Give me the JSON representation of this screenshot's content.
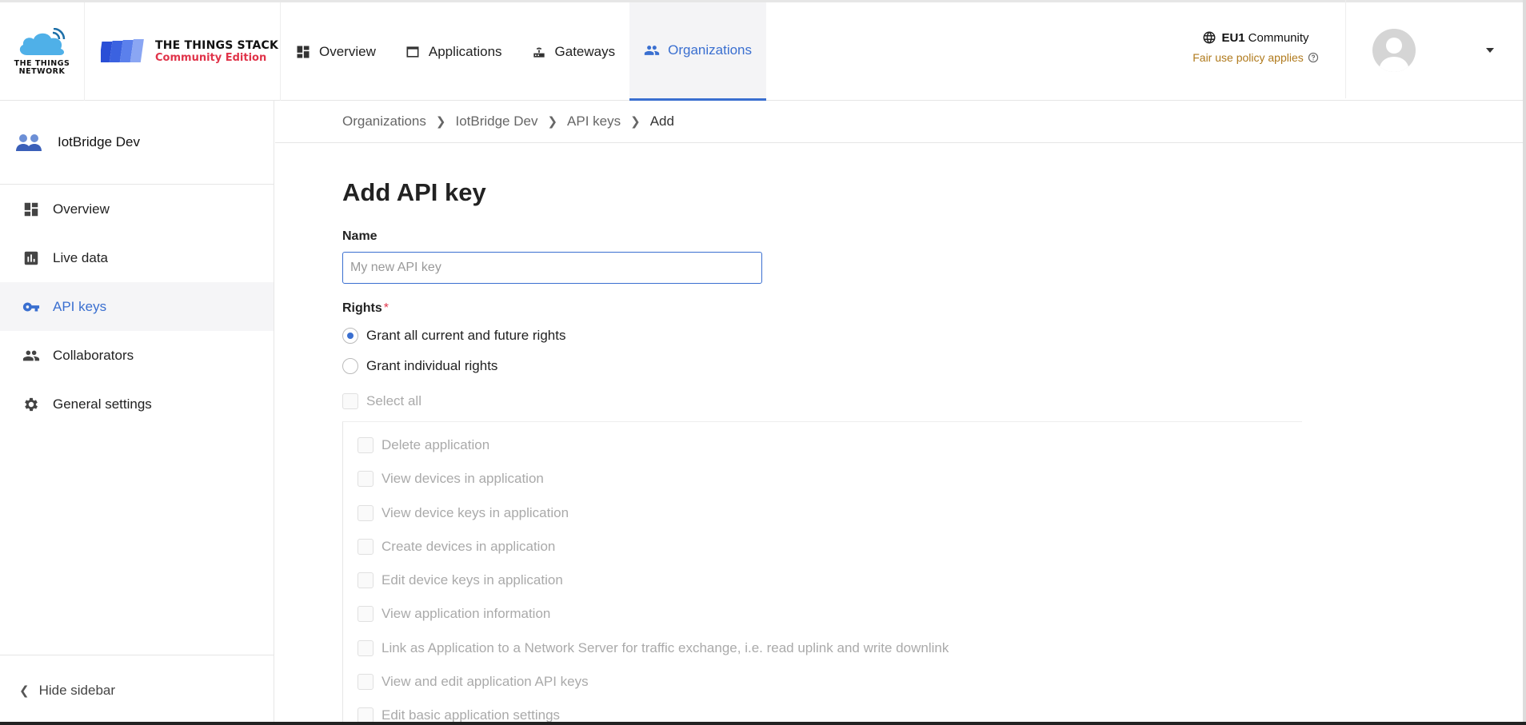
{
  "header": {
    "ttn_logo_text": "THE THINGS NETWORK",
    "tts_logo": {
      "line1": "THE THINGS STACK",
      "line2": "Community Edition"
    },
    "nav": [
      {
        "label": "Overview",
        "icon": "dashboard-icon"
      },
      {
        "label": "Applications",
        "icon": "window-icon"
      },
      {
        "label": "Gateways",
        "icon": "router-icon"
      },
      {
        "label": "Organizations",
        "icon": "people-icon",
        "active": true
      }
    ],
    "region": {
      "name": "EU1",
      "suffix": "Community",
      "policy": "Fair use policy applies"
    }
  },
  "sidebar": {
    "org_name": "IotBridge Dev",
    "items": [
      {
        "label": "Overview",
        "icon": "dashboard-icon"
      },
      {
        "label": "Live data",
        "icon": "chart-icon"
      },
      {
        "label": "API keys",
        "icon": "key-icon",
        "active": true
      },
      {
        "label": "Collaborators",
        "icon": "people-icon"
      },
      {
        "label": "General settings",
        "icon": "gear-icon"
      }
    ],
    "hide_label": "Hide sidebar"
  },
  "breadcrumb": [
    "Organizations",
    "IotBridge Dev",
    "API keys",
    "Add"
  ],
  "form": {
    "title": "Add API key",
    "name_label": "Name",
    "name_placeholder": "My new API key",
    "name_value": "",
    "rights_label": "Rights",
    "rights_required_mark": "*",
    "radio_all": "Grant all current and future rights",
    "radio_individual": "Grant individual rights",
    "selected_option": "all",
    "select_all_label": "Select all",
    "rights": [
      "Delete application",
      "View devices in application",
      "View device keys in application",
      "Create devices in application",
      "Edit device keys in application",
      "View application information",
      "Link as Application to a Network Server for traffic exchange, i.e. read uplink and write downlink",
      "View and edit application API keys",
      "Edit basic application settings"
    ]
  },
  "colors": {
    "accent": "#3a6fd0",
    "brand_red": "#e0344a",
    "policy": "#b07a1c"
  }
}
